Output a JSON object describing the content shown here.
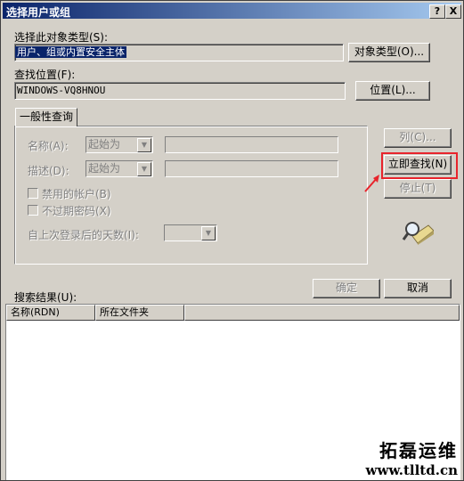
{
  "window": {
    "title": "选择用户或组",
    "help_btn": "?",
    "close_btn": "X"
  },
  "object_type": {
    "label": "选择此对象类型(S):",
    "value": "用户、组或内置安全主体",
    "button": "对象类型(O)..."
  },
  "location": {
    "label": "查找位置(F):",
    "value": "WINDOWS-VQ8HNOU",
    "button": "位置(L)..."
  },
  "tab": {
    "label": "一般性查询"
  },
  "query": {
    "name_label": "名称(A):",
    "name_mode": "起始为",
    "desc_label": "描述(D):",
    "desc_mode": "起始为",
    "disabled_accounts": "禁用的帐户(B)",
    "no_expire_pw": "不过期密码(X)",
    "days_label": "自上次登录后的天数(I):"
  },
  "side_buttons": {
    "columns": "列(C)...",
    "find_now": "立即查找(N)",
    "stop": "停止(T)"
  },
  "results": {
    "label": "搜索结果(U):",
    "ok": "确定",
    "cancel": "取消",
    "columns": [
      "名称(RDN)",
      "所在文件夹"
    ]
  },
  "watermark": {
    "line1": "拓磊运维",
    "line2": "www.tlltd.cn"
  },
  "colors": {
    "highlight": "#e8242c",
    "title_start": "#0a246a",
    "selection": "#0a246a"
  }
}
